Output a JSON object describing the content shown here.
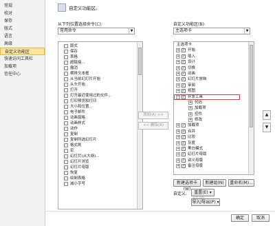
{
  "sidebar": {
    "items": [
      {
        "label": "常规"
      },
      {
        "label": "校对"
      },
      {
        "label": "保存"
      },
      {
        "label": "版式"
      },
      {
        "label": "语言"
      },
      {
        "label": "高级"
      },
      {
        "label": "自定义功能区",
        "active": true
      },
      {
        "label": "快速访问工具栏"
      },
      {
        "label": "加载项"
      },
      {
        "label": "信任中心"
      }
    ]
  },
  "header": {
    "title": "自定义功能区。"
  },
  "left_panel": {
    "label": "从下列位置选择命令(C):",
    "dropdown_value": "常用命令",
    "commands": [
      "版式",
      "保存",
      "表格",
      "超链接...",
      "撤消",
      "横排文本框",
      "从当前幻灯片开始",
      "从头开始",
      "打开",
      "打开最近使用过的文件...",
      "打印预览和打印",
      "大小和位置...",
      "电子邮件",
      "动画窗格",
      "动画样式",
      "动作",
      "复制",
      "复制所选幻灯片",
      "格式刷",
      "宏",
      "幻灯片(从大纲)...",
      "幻灯片浏览",
      "幻灯片母版",
      "恢复",
      "绘制表格",
      "减小字号"
    ]
  },
  "middle": {
    "add_label": "添加(A) >>",
    "remove_label": "<< 删除(R)"
  },
  "right_panel": {
    "label": "自定义功能区(B):",
    "dropdown_value": "主选项卡",
    "header_row": "主选项卡",
    "tabs": [
      {
        "label": "开始",
        "checked": true,
        "sub": false
      },
      {
        "label": "插入",
        "checked": true,
        "sub": false
      },
      {
        "label": "设计",
        "checked": true,
        "sub": false
      },
      {
        "label": "切换",
        "checked": true,
        "sub": false
      },
      {
        "label": "动画",
        "checked": true,
        "sub": false
      },
      {
        "label": "幻灯片放映",
        "checked": true,
        "sub": false
      },
      {
        "label": "审阅",
        "checked": true,
        "sub": false
      },
      {
        "label": "视图",
        "checked": true,
        "sub": false
      },
      {
        "label": "开发工具",
        "checked": true,
        "sub": false,
        "highlight": true,
        "expanded": true
      },
      {
        "label": "代码",
        "checked": false,
        "sub": true
      },
      {
        "label": "加载项",
        "checked": false,
        "sub": true
      },
      {
        "label": "控件",
        "checked": false,
        "sub": true
      },
      {
        "label": "修改",
        "checked": false,
        "sub": true
      },
      {
        "label": "加载项",
        "checked": true,
        "sub": false
      },
      {
        "label": "合并",
        "checked": true,
        "sub": false
      },
      {
        "label": "比较",
        "checked": true,
        "sub": false
      },
      {
        "label": "灰度",
        "checked": true,
        "sub": false
      },
      {
        "label": "黑白模式",
        "checked": true,
        "sub": false
      },
      {
        "label": "幻灯片母版",
        "checked": true,
        "sub": false
      },
      {
        "label": "讲义母版",
        "checked": true,
        "sub": false
      },
      {
        "label": "备注母版",
        "checked": true,
        "sub": false
      }
    ],
    "new_tab_label": "新建选项卡(W)",
    "new_group_label": "新建组(N)",
    "rename_label": "重命名(M)...",
    "custom_label": "自定义:",
    "reset_label": "重置(E)",
    "import_export_label": "导入/导出(P)"
  },
  "footer": {
    "ok_label": "确定",
    "cancel_label": "取消"
  },
  "watermark": "经验"
}
